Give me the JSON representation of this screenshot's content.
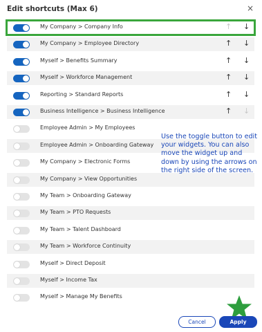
{
  "dialog": {
    "title": "Edit shortcuts (Max 6)",
    "close_glyph": "×"
  },
  "shortcuts": [
    {
      "label": "My Company > Company Info",
      "enabled": true,
      "up_enabled": false,
      "down_enabled": true
    },
    {
      "label": "My Company > Employee Directory",
      "enabled": true,
      "up_enabled": true,
      "down_enabled": true
    },
    {
      "label": "Myself > Benefits Summary",
      "enabled": true,
      "up_enabled": true,
      "down_enabled": true
    },
    {
      "label": "Myself > Workforce Management",
      "enabled": true,
      "up_enabled": true,
      "down_enabled": true
    },
    {
      "label": "Reporting > Standard Reports",
      "enabled": true,
      "up_enabled": true,
      "down_enabled": true
    },
    {
      "label": "Business Intelligence > Business Intelligence",
      "enabled": true,
      "up_enabled": true,
      "down_enabled": false
    },
    {
      "label": "Employee Admin > My Employees",
      "enabled": false
    },
    {
      "label": "Employee Admin > Onboarding Gateway",
      "enabled": false
    },
    {
      "label": "My Company > Electronic Forms",
      "enabled": false
    },
    {
      "label": "My Company > View Opportunities",
      "enabled": false
    },
    {
      "label": "My Team > Onboarding Gateway",
      "enabled": false
    },
    {
      "label": "My Team > PTO Requests",
      "enabled": false
    },
    {
      "label": "My Team > Talent Dashboard",
      "enabled": false
    },
    {
      "label": "My Team > Workforce Continuity",
      "enabled": false
    },
    {
      "label": "Myself > Direct Deposit",
      "enabled": false
    },
    {
      "label": "Myself > Income Tax",
      "enabled": false
    },
    {
      "label": "Myself > Manage My Benefits",
      "enabled": false
    }
  ],
  "arrows": {
    "up": "↑",
    "down": "↓"
  },
  "callout": "Use the toggle button to edit your widgets.  You can also move the widget up and down by using the arrows on the right side of the screen.",
  "buttons": {
    "cancel": "Cancel",
    "apply": "Apply"
  },
  "colors": {
    "toggle_on": "#1565c0",
    "toggle_off": "#e3e3e3",
    "highlight_outline": "#3aa63c",
    "callout_text": "#1a47b8",
    "star": "#2e9e3e",
    "apply_bg": "#1a47b8"
  },
  "icons": {
    "close": "close-icon",
    "star": "star-icon",
    "up": "arrow-up-icon",
    "down": "arrow-down-icon"
  }
}
